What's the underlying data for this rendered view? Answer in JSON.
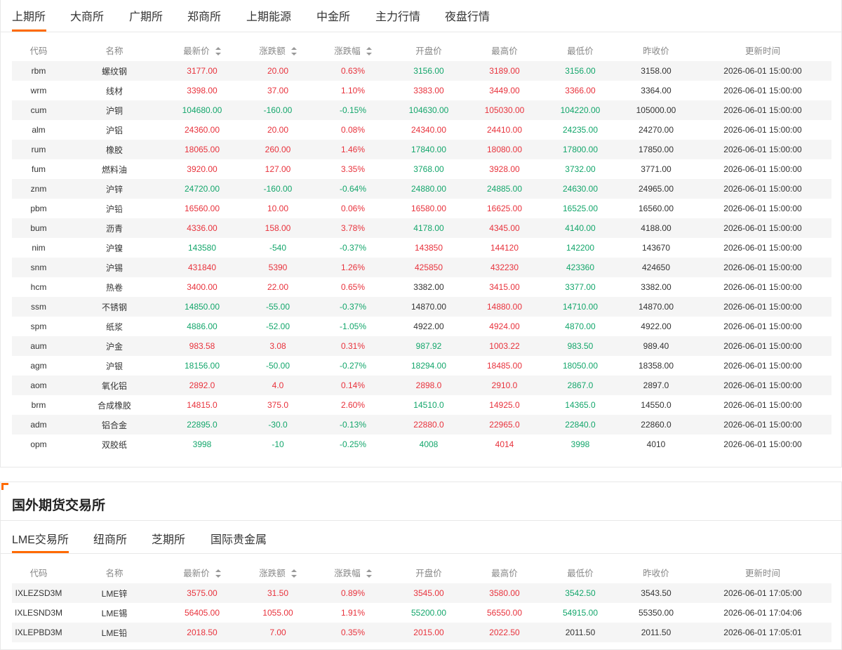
{
  "domestic": {
    "tabs": [
      "上期所",
      "大商所",
      "广期所",
      "郑商所",
      "上期能源",
      "中金所",
      "主力行情",
      "夜盘行情"
    ],
    "active_tab": 0,
    "columns": [
      "代码",
      "名称",
      "最新价",
      "涨跌额",
      "涨跌幅",
      "开盘价",
      "最高价",
      "最低价",
      "昨收价",
      "更新时间"
    ],
    "rows": [
      {
        "code": "rbm",
        "name": "螺纹钢",
        "last": "3177.00",
        "chg": "20.00",
        "pct": "0.63%",
        "open": "3156.00",
        "high": "3189.00",
        "low": "3156.00",
        "prev": "3158.00",
        "time": "2026-06-01 15:00:00",
        "c": [
          "up",
          "up",
          "up",
          "down",
          "up",
          "down"
        ]
      },
      {
        "code": "wrm",
        "name": "线材",
        "last": "3398.00",
        "chg": "37.00",
        "pct": "1.10%",
        "open": "3383.00",
        "high": "3449.00",
        "low": "3366.00",
        "prev": "3364.00",
        "time": "2026-06-01 15:00:00",
        "c": [
          "up",
          "up",
          "up",
          "up",
          "up",
          "up"
        ]
      },
      {
        "code": "cum",
        "name": "沪铜",
        "last": "104680.00",
        "chg": "-160.00",
        "pct": "-0.15%",
        "open": "104630.00",
        "high": "105030.00",
        "low": "104220.00",
        "prev": "105000.00",
        "time": "2026-06-01 15:00:00",
        "c": [
          "down",
          "down",
          "down",
          "down",
          "up",
          "down"
        ]
      },
      {
        "code": "alm",
        "name": "沪铝",
        "last": "24360.00",
        "chg": "20.00",
        "pct": "0.08%",
        "open": "24340.00",
        "high": "24410.00",
        "low": "24235.00",
        "prev": "24270.00",
        "time": "2026-06-01 15:00:00",
        "c": [
          "up",
          "up",
          "up",
          "up",
          "up",
          "down"
        ]
      },
      {
        "code": "rum",
        "name": "橡胶",
        "last": "18065.00",
        "chg": "260.00",
        "pct": "1.46%",
        "open": "17840.00",
        "high": "18080.00",
        "low": "17800.00",
        "prev": "17850.00",
        "time": "2026-06-01 15:00:00",
        "c": [
          "up",
          "up",
          "up",
          "down",
          "up",
          "down"
        ]
      },
      {
        "code": "fum",
        "name": "燃料油",
        "last": "3920.00",
        "chg": "127.00",
        "pct": "3.35%",
        "open": "3768.00",
        "high": "3928.00",
        "low": "3732.00",
        "prev": "3771.00",
        "time": "2026-06-01 15:00:00",
        "c": [
          "up",
          "up",
          "up",
          "down",
          "up",
          "down"
        ]
      },
      {
        "code": "znm",
        "name": "沪锌",
        "last": "24720.00",
        "chg": "-160.00",
        "pct": "-0.64%",
        "open": "24880.00",
        "high": "24885.00",
        "low": "24630.00",
        "prev": "24965.00",
        "time": "2026-06-01 15:00:00",
        "c": [
          "down",
          "down",
          "down",
          "down",
          "down",
          "down"
        ]
      },
      {
        "code": "pbm",
        "name": "沪铅",
        "last": "16560.00",
        "chg": "10.00",
        "pct": "0.06%",
        "open": "16580.00",
        "high": "16625.00",
        "low": "16525.00",
        "prev": "16560.00",
        "time": "2026-06-01 15:00:00",
        "c": [
          "up",
          "up",
          "up",
          "up",
          "up",
          "down"
        ]
      },
      {
        "code": "bum",
        "name": "沥青",
        "last": "4336.00",
        "chg": "158.00",
        "pct": "3.78%",
        "open": "4178.00",
        "high": "4345.00",
        "low": "4140.00",
        "prev": "4188.00",
        "time": "2026-06-01 15:00:00",
        "c": [
          "up",
          "up",
          "up",
          "down",
          "up",
          "down"
        ]
      },
      {
        "code": "nim",
        "name": "沪镍",
        "last": "143580",
        "chg": "-540",
        "pct": "-0.37%",
        "open": "143850",
        "high": "144120",
        "low": "142200",
        "prev": "143670",
        "time": "2026-06-01 15:00:00",
        "c": [
          "down",
          "down",
          "down",
          "up",
          "up",
          "down"
        ]
      },
      {
        "code": "snm",
        "name": "沪锡",
        "last": "431840",
        "chg": "5390",
        "pct": "1.26%",
        "open": "425850",
        "high": "432230",
        "low": "423360",
        "prev": "424650",
        "time": "2026-06-01 15:00:00",
        "c": [
          "up",
          "up",
          "up",
          "up",
          "up",
          "down"
        ]
      },
      {
        "code": "hcm",
        "name": "热卷",
        "last": "3400.00",
        "chg": "22.00",
        "pct": "0.65%",
        "open": "3382.00",
        "high": "3415.00",
        "low": "3377.00",
        "prev": "3382.00",
        "time": "2026-06-01 15:00:00",
        "c": [
          "up",
          "up",
          "up",
          "flat",
          "up",
          "down"
        ]
      },
      {
        "code": "ssm",
        "name": "不锈钢",
        "last": "14850.00",
        "chg": "-55.00",
        "pct": "-0.37%",
        "open": "14870.00",
        "high": "14880.00",
        "low": "14710.00",
        "prev": "14870.00",
        "time": "2026-06-01 15:00:00",
        "c": [
          "down",
          "down",
          "down",
          "flat",
          "up",
          "down"
        ]
      },
      {
        "code": "spm",
        "name": "纸浆",
        "last": "4886.00",
        "chg": "-52.00",
        "pct": "-1.05%",
        "open": "4922.00",
        "high": "4924.00",
        "low": "4870.00",
        "prev": "4922.00",
        "time": "2026-06-01 15:00:00",
        "c": [
          "down",
          "down",
          "down",
          "flat",
          "up",
          "down"
        ]
      },
      {
        "code": "aum",
        "name": "沪金",
        "last": "983.58",
        "chg": "3.08",
        "pct": "0.31%",
        "open": "987.92",
        "high": "1003.22",
        "low": "983.50",
        "prev": "989.40",
        "time": "2026-06-01 15:00:00",
        "c": [
          "up",
          "up",
          "up",
          "down",
          "up",
          "down"
        ]
      },
      {
        "code": "agm",
        "name": "沪银",
        "last": "18156.00",
        "chg": "-50.00",
        "pct": "-0.27%",
        "open": "18294.00",
        "high": "18485.00",
        "low": "18050.00",
        "prev": "18358.00",
        "time": "2026-06-01 15:00:00",
        "c": [
          "down",
          "down",
          "down",
          "down",
          "up",
          "down"
        ]
      },
      {
        "code": "aom",
        "name": "氧化铝",
        "last": "2892.0",
        "chg": "4.0",
        "pct": "0.14%",
        "open": "2898.0",
        "high": "2910.0",
        "low": "2867.0",
        "prev": "2897.0",
        "time": "2026-06-01 15:00:00",
        "c": [
          "up",
          "up",
          "up",
          "up",
          "up",
          "down"
        ]
      },
      {
        "code": "brm",
        "name": "合成橡胶",
        "last": "14815.0",
        "chg": "375.0",
        "pct": "2.60%",
        "open": "14510.0",
        "high": "14925.0",
        "low": "14365.0",
        "prev": "14550.0",
        "time": "2026-06-01 15:00:00",
        "c": [
          "up",
          "up",
          "up",
          "down",
          "up",
          "down"
        ]
      },
      {
        "code": "adm",
        "name": "铝合金",
        "last": "22895.0",
        "chg": "-30.0",
        "pct": "-0.13%",
        "open": "22880.0",
        "high": "22965.0",
        "low": "22840.0",
        "prev": "22860.0",
        "time": "2026-06-01 15:00:00",
        "c": [
          "down",
          "down",
          "down",
          "up",
          "up",
          "down"
        ]
      },
      {
        "code": "opm",
        "name": "双胶纸",
        "last": "3998",
        "chg": "-10",
        "pct": "-0.25%",
        "open": "4008",
        "high": "4014",
        "low": "3998",
        "prev": "4010",
        "time": "2026-06-01 15:00:00",
        "c": [
          "down",
          "down",
          "down",
          "down",
          "up",
          "down"
        ]
      }
    ]
  },
  "foreign": {
    "title": "国外期货交易所",
    "tabs": [
      "LME交易所",
      "纽商所",
      "芝期所",
      "国际贵金属"
    ],
    "active_tab": 0,
    "columns": [
      "代码",
      "名称",
      "最新价",
      "涨跌额",
      "涨跌幅",
      "开盘价",
      "最高价",
      "最低价",
      "昨收价",
      "更新时间"
    ],
    "rows": [
      {
        "code": "IXLEZSD3M",
        "name": "LME锌",
        "last": "3575.00",
        "chg": "31.50",
        "pct": "0.89%",
        "open": "3545.00",
        "high": "3580.00",
        "low": "3542.50",
        "prev": "3543.50",
        "time": "2026-06-01 17:05:00",
        "c": [
          "up",
          "up",
          "up",
          "up",
          "up",
          "down"
        ]
      },
      {
        "code": "IXLESND3M",
        "name": "LME锡",
        "last": "56405.00",
        "chg": "1055.00",
        "pct": "1.91%",
        "open": "55200.00",
        "high": "56550.00",
        "low": "54915.00",
        "prev": "55350.00",
        "time": "2026-06-01 17:04:06",
        "c": [
          "up",
          "up",
          "up",
          "down",
          "up",
          "down"
        ]
      },
      {
        "code": "IXLEPBD3M",
        "name": "LME铅",
        "last": "2018.50",
        "chg": "7.00",
        "pct": "0.35%",
        "open": "2015.00",
        "high": "2022.50",
        "low": "2011.50",
        "prev": "2011.50",
        "time": "2026-06-01 17:05:01",
        "c": [
          "up",
          "up",
          "up",
          "up",
          "up",
          "flat"
        ]
      }
    ]
  }
}
